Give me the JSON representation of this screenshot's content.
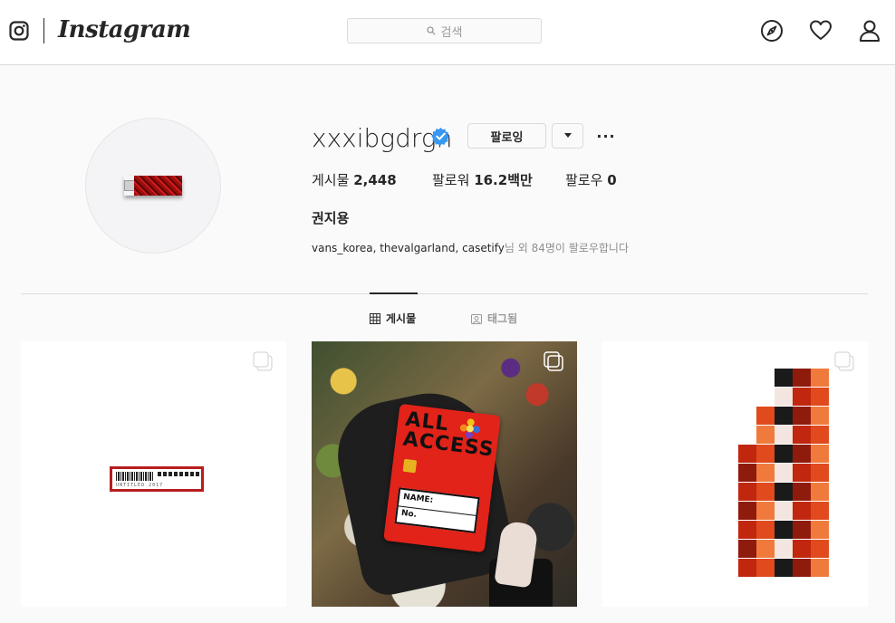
{
  "nav": {
    "brand": "Instagram",
    "search_placeholder": "검색"
  },
  "profile": {
    "username": "xxxibgdrgn",
    "verified": true,
    "follow_button_label": "팔로잉",
    "more_label": "···",
    "stats": {
      "posts_label": "게시물",
      "posts_value": "2,448",
      "followers_label": "팔로워",
      "followers_value": "16.2백만",
      "following_label": "팔로우",
      "following_value": "0"
    },
    "full_name": "권지용",
    "followed_by_names": "vans_korea, thevalgarland, casetify",
    "followed_by_suffix": "님 외 84명이 팔로우합니다"
  },
  "tabs": [
    {
      "label": "게시물",
      "active": true
    },
    {
      "label": "태그됨",
      "active": false
    }
  ],
  "posts": [
    {
      "multiple": true,
      "barcode_text": "UNTITLED 2017"
    },
    {
      "multiple": true,
      "card_title_line1": "ALL",
      "card_title_line2": "ACCESS",
      "card_name_label": "NAME:",
      "card_no_label": "No."
    },
    {
      "multiple": true
    }
  ],
  "colors": {
    "verified_blue": "#3897f0",
    "text": "#262626",
    "muted": "#8e8e8e",
    "border": "#dbdbdb"
  }
}
